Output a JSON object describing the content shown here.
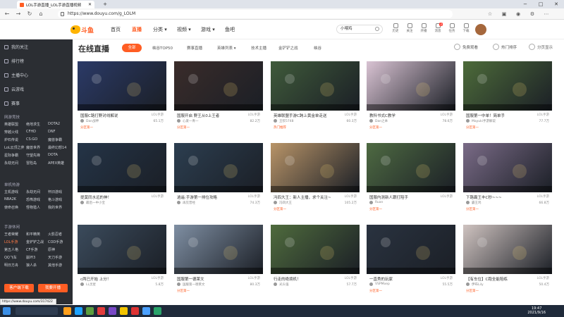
{
  "browser": {
    "tab_title": "LOL手游直播_LOL手游直播视频",
    "url": "https://www.douyu.com/g_LOLM",
    "controls": [
      "−",
      "□",
      "✕"
    ]
  },
  "header": {
    "logo_text": "斗鱼",
    "nav": [
      "首页",
      "直播",
      "分类",
      "视频",
      "游戏",
      "鱼吧"
    ],
    "active_nav": "直播",
    "search_placeholder": "小喂鸡",
    "icons": [
      {
        "name": "history-icon",
        "label": "历史"
      },
      {
        "name": "follow-icon",
        "label": "关注"
      },
      {
        "name": "broadcast-icon",
        "label": "开播"
      },
      {
        "name": "message-icon",
        "label": "消息",
        "badge": "2"
      },
      {
        "name": "task-icon",
        "label": "任务"
      },
      {
        "name": "app-icon",
        "label": "下载"
      },
      {
        "name": "recharge-icon",
        "label": "充值"
      }
    ]
  },
  "sidebar": {
    "items": [
      {
        "label": "我的关注",
        "icon": "heart-icon"
      },
      {
        "label": "排行榜",
        "icon": "rank-icon"
      },
      {
        "label": "主播中心",
        "icon": "anchor-icon"
      },
      {
        "label": "云游戏",
        "icon": "cloud-icon"
      },
      {
        "label": "赛事",
        "icon": "trophy-icon"
      }
    ],
    "section1": "网游竞技",
    "games1": [
      "英雄联盟",
      "绝地求生",
      "DOTA2",
      "穿越火线",
      "CFHD",
      "DNF",
      "炉石传说",
      "CS:GO",
      "魔兽争霸",
      "LoL云顶之弈",
      "魔兽世界",
      "最终幻想14",
      "星际争霸",
      "守望先锋",
      "DOTA",
      "永劫无间",
      "冒险岛",
      "APEX英雄"
    ],
    "section2": "单机热游",
    "games2": [
      "主机游戏",
      "永劫无间",
      "怀旧游戏",
      "NBA2K",
      "恐怖游戏",
      "格斗游戏",
      "使命召唤",
      "怪物猎人",
      "我的世界"
    ],
    "section3": "手游休闲",
    "games3": [
      "王者荣耀",
      "和平精英",
      "火影忍者",
      "LOL手游",
      "金铲铲之战",
      "COD手游",
      "第五人格",
      "CF手游",
      "原神",
      "QQ飞车",
      "崩坏3",
      "天刀手游",
      "明日方舟",
      "狼人杀",
      "其他手游"
    ],
    "selected_game": "LOL手游",
    "btn_left": "客户端下载",
    "btn_right": "我要开播"
  },
  "main": {
    "title": "在线直播",
    "all_label": "全部",
    "categories": [
      "峡谷TOP50",
      "赛事直播",
      "英雄列表",
      "技术主播",
      "金铲铲之战",
      "峡谷"
    ],
    "options": [
      "免费观看",
      "热门排序",
      "分页显示"
    ],
    "streams": [
      {
        "title": "国服C路打野对线解说",
        "cat": "LOL手游",
        "streamer": "Dan战神",
        "heat": "65.1万",
        "tag": "分区第一",
        "bg": "#2b3a67"
      },
      {
        "title": "国服开启 野王从0上王者",
        "cat": "LOL手游",
        "streamer": "心爱一青一",
        "heat": "82.2万",
        "tag": "分区第一",
        "bg": "#3a2c2a"
      },
      {
        "title": "英雄联盟手游C跨上黄金单走送",
        "cat": "LOL手游",
        "streamer": "王钦5748",
        "heat": "60.3万",
        "tag": "热门推荐",
        "bg": "#3f5a3a"
      },
      {
        "title": "教科书式C教学",
        "cat": "LOL手游",
        "streamer": "Dan之本",
        "heat": "78.6万",
        "tag": "分区第一",
        "bg": "#d9c3d3"
      },
      {
        "title": "国服第一中单！简单手",
        "cat": "LOL手游",
        "streamer": "Mayuki手游解说",
        "heat": "77.7万",
        "tag": "分区第一",
        "bg": "#4d6b3a"
      },
      {
        "title": "提莫同水远的神！",
        "cat": "LOL手游",
        "streamer": "最后一中小宝",
        "heat": "",
        "tag": "",
        "bg": "#243447"
      },
      {
        "title": "逍遥:手游第一排位攻略",
        "cat": "LOL手游",
        "streamer": "再见曾经",
        "heat": "74.3万",
        "tag": "",
        "bg": "#2c3e50"
      },
      {
        "title": "冯四大王：新人主播，求个关注~",
        "cat": "LOL手游",
        "streamer": "冯四大王",
        "heat": "105.2万",
        "tag": "分区第一",
        "bg": "#b89468"
      },
      {
        "title": "国服内测新人跟打陪手",
        "cat": "LOL手游",
        "streamer": "Ruan",
        "heat": "",
        "tag": "分区第一",
        "bg": "#4e6a42"
      },
      {
        "title": "下路霸王丰C秒~~~",
        "cat": "LOL手游",
        "streamer": "霸王鸡",
        "heat": "66.8万",
        "tag": "分区第一",
        "bg": "#7a6b87"
      },
      {
        "title": "c两已开始 上分！",
        "cat": "LOL手游",
        "streamer": "LL灵星",
        "heat": "5.8万",
        "tag": "",
        "bg": "#3b4b5c"
      },
      {
        "title": "国服第一德莱文",
        "cat": "LOL手游",
        "streamer": "国服第一德莱文",
        "heat": "80.3万",
        "tag": "分区第一",
        "bg": "#7f8fa3"
      },
      {
        "title": "行走的绝境机！",
        "cat": "LOL手游",
        "streamer": "光头强",
        "heat": "57.7万",
        "tag": "",
        "bg": "#4f6b3d"
      },
      {
        "title": "一直秀的玩家",
        "cat": "LOL手游",
        "streamer": "VSPMoep",
        "heat": "55.5万",
        "tag": "分区第一",
        "bg": "#2a3340"
      },
      {
        "title": "【有车位】C跑全能陪练",
        "cat": "LOL手游",
        "streamer": "伊布Lily",
        "heat": "50.4万",
        "tag": "分区第一",
        "bg": "#cfc3c0"
      }
    ]
  },
  "status_url": "https://www.douyu.com/317422",
  "clock": {
    "time": "19:47",
    "date": "2021/9/16"
  }
}
